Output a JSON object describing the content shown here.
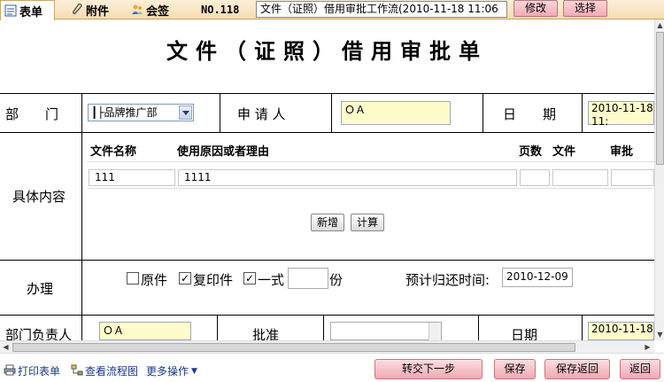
{
  "tabs": [
    {
      "label": "表单",
      "icon": "form-icon"
    },
    {
      "label": "附件",
      "icon": "paperclip-icon"
    },
    {
      "label": "会签",
      "icon": "users-icon"
    }
  ],
  "doc_no": "NO.118",
  "workflow_title": "文件（证照）借用审批工作流(2010-11-18 11:06",
  "top_buttons": {
    "modify": "修改",
    "select": "选择"
  },
  "form": {
    "title": "文件（证照）借用审批单",
    "department_label": "部　　门",
    "department_value": "┃├品牌推广部",
    "applicant_label": "申 请 人",
    "applicant_value": "ＯＡ",
    "date_label": "日　　期",
    "date_value": "2010-11-18 11:",
    "content_label": "具体内容",
    "table_headers": [
      "文件名称",
      "使用原因或者理由",
      "页数",
      "文件",
      "审批"
    ],
    "table_row": [
      "111",
      "1111",
      "",
      "",
      ""
    ],
    "add_button": "新增",
    "calc_button": "计算",
    "handle_label": "办理",
    "original_label": "原件",
    "copy_label": "复印件",
    "one_label": "一式",
    "copies_unit": "份",
    "return_time_label": "预计归还时间:",
    "return_time_value": "2010-12-09",
    "checks": {
      "original": false,
      "copy": true,
      "one": true
    },
    "dept_head_label": "部门负责人",
    "dept_head_value": "ＯＡ",
    "approve_label": "批准",
    "date2_label": "日期",
    "date2_value": "2010-11-18"
  },
  "bottom": {
    "print_label": "打印表单",
    "flowchart_label": "查看流程图",
    "more_label": "更多操作",
    "submit_label": "转交下一步",
    "save_label": "保存",
    "save_return_label": "保存返回",
    "back_label": "返回"
  },
  "colors": {
    "toolbar": "#f5dcb0",
    "pink_button": "#f2aab6",
    "yellow_field": "#fffccc",
    "link": "#1a3a8a"
  }
}
